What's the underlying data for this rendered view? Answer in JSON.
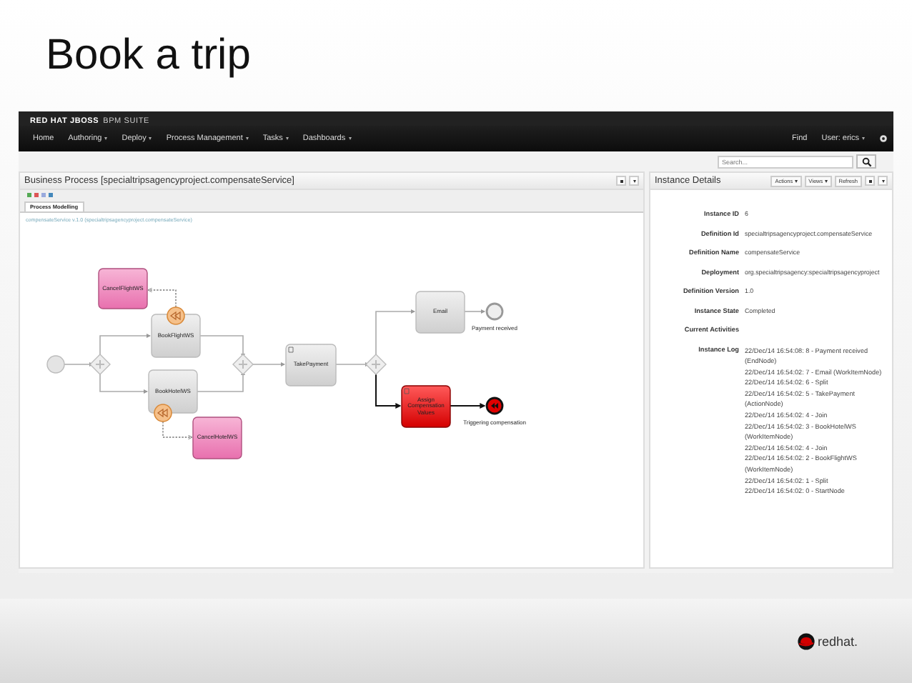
{
  "slide": {
    "title": "Book a trip",
    "logo_text": "redhat."
  },
  "app": {
    "brand": "RED HAT JBOSS",
    "product": "BPM SUITE",
    "nav": [
      {
        "label": "Home",
        "dropdown": false
      },
      {
        "label": "Authoring",
        "dropdown": true
      },
      {
        "label": "Deploy",
        "dropdown": true
      },
      {
        "label": "Process Management",
        "dropdown": true
      },
      {
        "label": "Tasks",
        "dropdown": true
      },
      {
        "label": "Dashboards",
        "dropdown": true
      }
    ],
    "nav_right": [
      {
        "label": "Find",
        "dropdown": false
      },
      {
        "label": "User: erics",
        "dropdown": true
      }
    ],
    "search": {
      "placeholder": "Search..."
    }
  },
  "process_panel": {
    "title": "Business Process [specialtripsagencyproject.compensateService]",
    "tabs": [
      {
        "label": "Process Modelling",
        "selected": true
      }
    ],
    "link": "compensateService v.1.0 (specialtripsagencyproject.compensateService)",
    "nodes": [
      {
        "kind": "start"
      },
      {
        "kind": "gateway"
      },
      {
        "kind": "task",
        "label": "BookFlightWS"
      },
      {
        "kind": "boundary"
      },
      {
        "kind": "compensation",
        "label": "CancelFlightWS"
      },
      {
        "kind": "task",
        "label": "BookHotelWS"
      },
      {
        "kind": "boundary"
      },
      {
        "kind": "compensation",
        "label": "CancelHotelWS"
      },
      {
        "kind": "gateway"
      },
      {
        "kind": "task",
        "label": "TakePayment"
      },
      {
        "kind": "gateway"
      },
      {
        "kind": "task",
        "label": "Email"
      },
      {
        "kind": "end",
        "label": "Payment received"
      },
      {
        "kind": "script",
        "label": "Assign Compensation Values"
      },
      {
        "kind": "compensate-end",
        "label": "Triggering compensation"
      }
    ]
  },
  "details_panel": {
    "title": "Instance Details",
    "buttons": [
      {
        "label": "Actions",
        "dropdown": true
      },
      {
        "label": "Views",
        "dropdown": true
      },
      {
        "label": "Refresh",
        "dropdown": false
      }
    ],
    "fields": [
      {
        "label": "Instance ID",
        "value": "6"
      },
      {
        "label": "Definition Id",
        "value": "specialtripsagencyproject.compensateService"
      },
      {
        "label": "Definition Name",
        "value": "compensateService"
      },
      {
        "label": "Deployment",
        "value": "org.specialtripsagency:specialtripsagencyproject"
      },
      {
        "label": "Definition Version",
        "value": "1.0"
      },
      {
        "label": "Instance State",
        "value": "Completed"
      },
      {
        "label": "Current Activities"
      }
    ],
    "log_label": "Instance Log",
    "log": [
      "22/Dec/14 16:54:08: 8 - Payment received (EndNode)",
      "22/Dec/14 16:54:02: 7 - Email (WorkItemNode)",
      "22/Dec/14 16:54:02: 6 - Split",
      "22/Dec/14 16:54:02: 5 - TakePayment (ActionNode)",
      "22/Dec/14 16:54:02: 4 - Join",
      "22/Dec/14 16:54:02: 3 - BookHotelWS (WorkItemNode)",
      "22/Dec/14 16:54:02: 4 - Join",
      "22/Dec/14 16:54:02: 2 - BookFlightWS (WorkItemNode)",
      "22/Dec/14 16:54:02: 1 - Split",
      "22/Dec/14 16:54:02: 0 - StartNode"
    ]
  }
}
